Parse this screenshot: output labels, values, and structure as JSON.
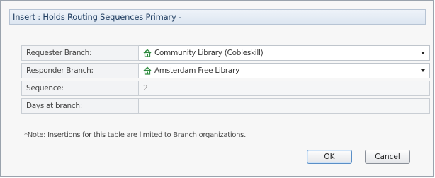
{
  "dialog": {
    "title": "Insert : Holds Routing Sequences Primary -"
  },
  "form": {
    "requester": {
      "label": "Requester Branch:",
      "value": "Community Library (Cobleskill)"
    },
    "responder": {
      "label": "Responder Branch:",
      "value": "Amsterdam Free Library"
    },
    "sequence": {
      "label": "Sequence:",
      "value": "2"
    },
    "days": {
      "label": "Days at branch:",
      "value": ""
    }
  },
  "note": "*Note: Insertions for this table are limited to Branch organizations.",
  "buttons": {
    "ok": "OK",
    "cancel": "Cancel"
  },
  "icons": {
    "branch": "home-icon",
    "dropdown": "chevron-down-icon"
  },
  "colors": {
    "icon_green": "#2e8b3e",
    "title_text": "#1c3a5e"
  }
}
